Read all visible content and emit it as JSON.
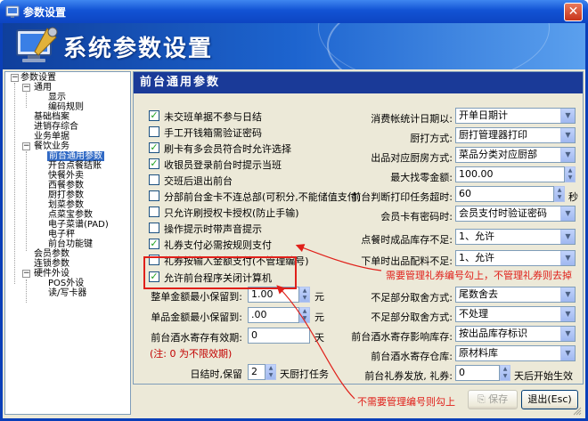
{
  "window": {
    "title": "参数设置"
  },
  "banner": {
    "title": "系统参数设置"
  },
  "tree": {
    "items": [
      {
        "label": "参数设置"
      },
      {
        "label": "通用"
      },
      {
        "label": "显示"
      },
      {
        "label": "编码规则"
      },
      {
        "label": "基础档案"
      },
      {
        "label": "进销存综合"
      },
      {
        "label": "业务单据"
      },
      {
        "label": "餐饮业务"
      },
      {
        "label": "前台通用参数"
      },
      {
        "label": "开台点餐结账"
      },
      {
        "label": "快餐外卖"
      },
      {
        "label": "西餐参数"
      },
      {
        "label": "厨打参数"
      },
      {
        "label": "划菜参数"
      },
      {
        "label": "点菜宝参数"
      },
      {
        "label": "电子菜谱(PAD)"
      },
      {
        "label": "电子秤"
      },
      {
        "label": "前台功能键"
      },
      {
        "label": "会员参数"
      },
      {
        "label": "连锁参数"
      },
      {
        "label": "硬件外设"
      },
      {
        "label": "POS外设"
      },
      {
        "label": "读/写卡器"
      }
    ]
  },
  "panel": {
    "title": "前台通用参数",
    "checkboxes": [
      {
        "label": "未交班单据不参与日结"
      },
      {
        "label": "手工开钱箱需验证密码"
      },
      {
        "label": "刷卡有多会员符合时允许选择"
      },
      {
        "label": "收银员登录前台时提示当班"
      },
      {
        "label": "交班后退出前台"
      },
      {
        "label": "分部前台金卡不连总部(可积分,不能储值支付)"
      },
      {
        "label": "只允许刷授权卡授权(防止手输)"
      },
      {
        "label": "操作提示时带声音提示"
      },
      {
        "label": "礼券支付必需按规则支付"
      },
      {
        "label": "礼券按输入金额支付(不管理编号)"
      },
      {
        "label": "允许前台程序关闭计算机"
      }
    ],
    "left_fields": {
      "whole_round_label": "整单金额最小保留到:",
      "whole_round_value": "1.00",
      "single_round_label": "单品金额最小保留到:",
      "single_round_value": ".00",
      "wine_valid_label": "前台酒水寄存有效期:",
      "wine_valid_value": "0",
      "wine_unit": "天",
      "yuan1": "元",
      "yuan2": "元",
      "note": "(注: 0 为不限效期)",
      "daily_label": "日结时,保留",
      "daily_value": "2",
      "daily_suffix": "天厨打任务"
    },
    "right_fields": [
      {
        "label": "消费帐统计日期以:",
        "value": "开单日期计"
      },
      {
        "label": "厨打方式:",
        "value": "厨打管理器打印"
      },
      {
        "label": "出品对应厨房方式:",
        "value": "菜品分类对应厨部"
      },
      {
        "label": "最大找零金额:",
        "value": "100.00"
      },
      {
        "label": "前台判断打印任务超时:",
        "value": "60",
        "suffix": "秒"
      },
      {
        "label": "会员卡有密码时:",
        "value": "会员支付时验证密码"
      },
      {
        "label": "点餐时成品库存不足:",
        "value": "1、允许"
      },
      {
        "label": "下单时出品配料不足:",
        "value": "1、允许"
      },
      {
        "label": "不足部分取舍方式:",
        "value": "尾数舍去"
      },
      {
        "label": "不足部分取舍方式:",
        "value": "不处理"
      },
      {
        "label": "前台酒水寄存影响库存:",
        "value": "按出品库存标识"
      },
      {
        "label": "前台酒水寄存仓库:",
        "value": "原材料库"
      },
      {
        "label": "前台礼券发放, 礼券:",
        "value": "0",
        "suffix": "天后开始生效"
      }
    ]
  },
  "annotations": {
    "note_top": "需要管理礼券编号勾上，不管理礼券则去掉",
    "note_bottom": "不需要管理编号则勾上"
  },
  "buttons": {
    "save_label": "保存",
    "exit_label": "退出(Esc)"
  }
}
